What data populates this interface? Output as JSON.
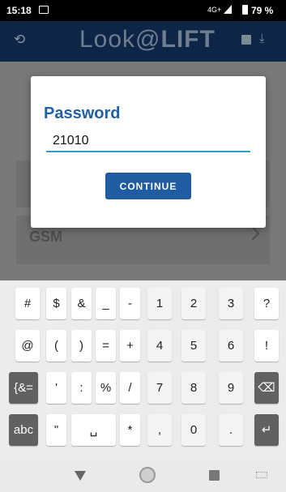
{
  "status_bar": {
    "time": "15:18",
    "network": "4G+",
    "battery": "79 %",
    "icons": [
      "image-notification-icon",
      "signal-icon",
      "battery-icon"
    ]
  },
  "app_bar": {
    "logo_left": "Look@",
    "logo_right": "LIFT",
    "icons": [
      "reload-icon",
      "save-icon",
      "download-icon"
    ]
  },
  "background": {
    "item_label": "GSM"
  },
  "dialog": {
    "title": "Password",
    "input_value": "21010",
    "button_label": "CONTINUE"
  },
  "keyboard": {
    "rows": [
      [
        "#",
        "$",
        "&",
        "_",
        "-",
        "1",
        "2",
        "3",
        "?"
      ],
      [
        "@",
        "(",
        ")",
        "=",
        "+",
        "4",
        "5",
        "6",
        "!"
      ],
      [
        "{&=",
        "'",
        ":",
        "%",
        "/",
        "7",
        "8",
        "9",
        "⌫"
      ],
      [
        "abc",
        "\"",
        "␣",
        "*",
        ",",
        "0",
        ".",
        "↵"
      ]
    ]
  },
  "nav_bar": {
    "icons": [
      "back-icon",
      "home-icon",
      "recents-icon",
      "keyboard-switch-icon"
    ]
  }
}
